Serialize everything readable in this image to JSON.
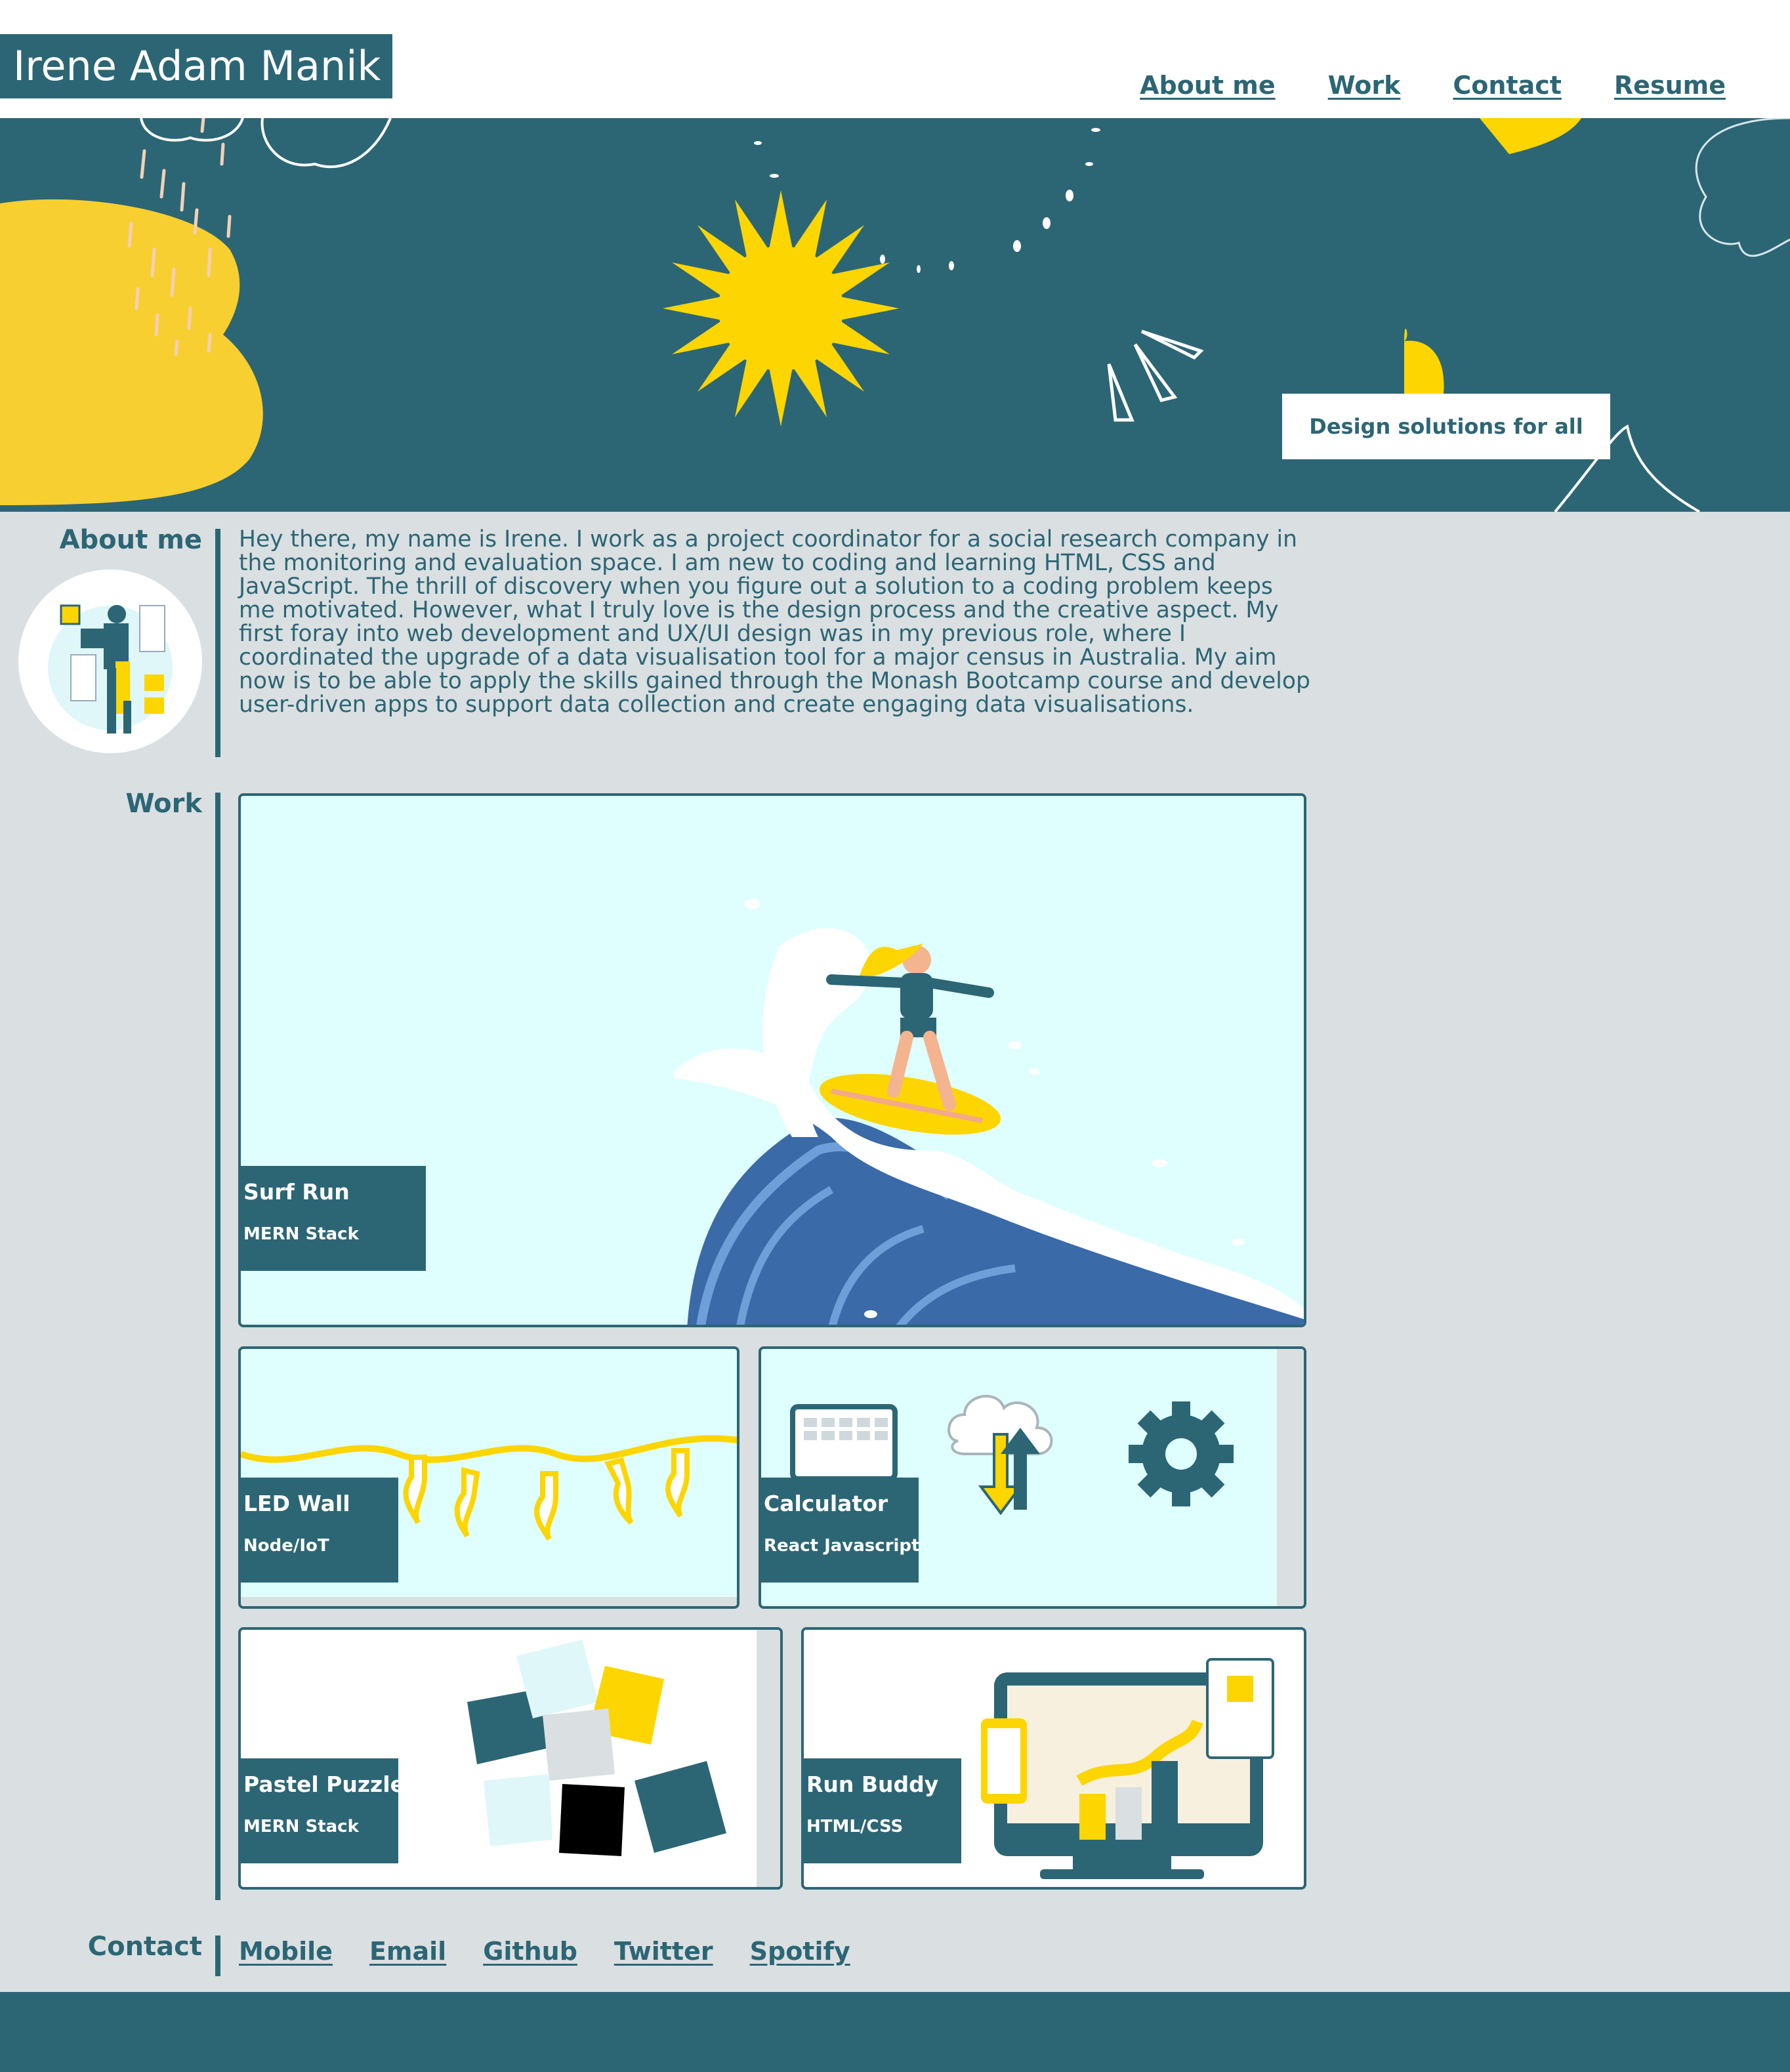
{
  "site": {
    "title": "Irene Adam Manik",
    "tagline": "Design solutions for all"
  },
  "nav": {
    "about": "About me",
    "work": "Work",
    "contact": "Contact",
    "resume": "Resume"
  },
  "about": {
    "heading": "About me",
    "text": "Hey there, my name is Irene. I work as a project coordinator for a social research company in the monitoring and evaluation space. I am new to coding and learning HTML, CSS and JavaScript. The thrill of discovery when you figure out a solution to a coding problem keeps me motivated. However, what I truly love is the design process and the creative aspect. My first foray into web development and UX/UI design was in my previous role, where I coordinated the upgrade of a data visualisation tool for a major census in Australia. My aim now is to be able to apply the skills gained through the Monash Bootcamp course and develop user-driven apps to support data collection and create engaging data visualisations."
  },
  "work": {
    "heading": "Work",
    "projects": [
      {
        "title": "Surf Run",
        "stack": "MERN Stack"
      },
      {
        "title": "LED Wall",
        "stack": "Node/IoT"
      },
      {
        "title": "Calculator",
        "stack": "React Javascript"
      },
      {
        "title": "Pastel Puzzles",
        "stack": "MERN Stack"
      },
      {
        "title": "Run Buddy",
        "stack": "HTML/CSS"
      }
    ]
  },
  "contact": {
    "heading": "Contact",
    "links": {
      "mobile": "Mobile",
      "email": "Email",
      "github": "Github",
      "twitter": "Twitter",
      "spotify": "Spotify"
    }
  },
  "colors": {
    "primary": "#2c6675",
    "background": "#dadfe1",
    "accent": "#fdd500",
    "card_bg": "#dfffff"
  }
}
